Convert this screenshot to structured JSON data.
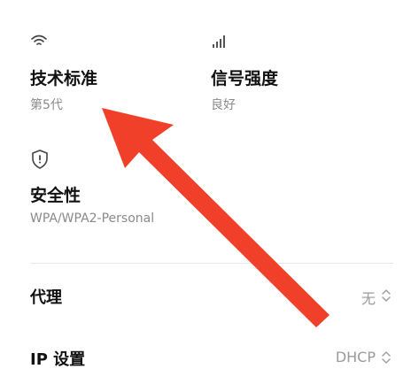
{
  "wifi_details": {
    "standard": {
      "icon": "wifi-icon",
      "title": "技术标准",
      "value": "第5代"
    },
    "signal": {
      "icon": "signal-bars-icon",
      "title": "信号强度",
      "value": "良好"
    },
    "security": {
      "icon": "shield-icon",
      "title": "安全性",
      "value": "WPA/WPA2-Personal"
    }
  },
  "settings": {
    "proxy": {
      "label": "代理",
      "value": "无",
      "icon": "chevron-updown-icon"
    },
    "ip": {
      "label": "IP 设置",
      "value": "DHCP",
      "icon": "chevron-updown-icon"
    }
  },
  "annotation": {
    "icon": "arrow-icon",
    "color": "#f0402a"
  },
  "colors": {
    "title_text": "#111111",
    "secondary_text": "#8a8a8a",
    "divider": "#e6e6e6",
    "arrow": "#f0402a"
  }
}
